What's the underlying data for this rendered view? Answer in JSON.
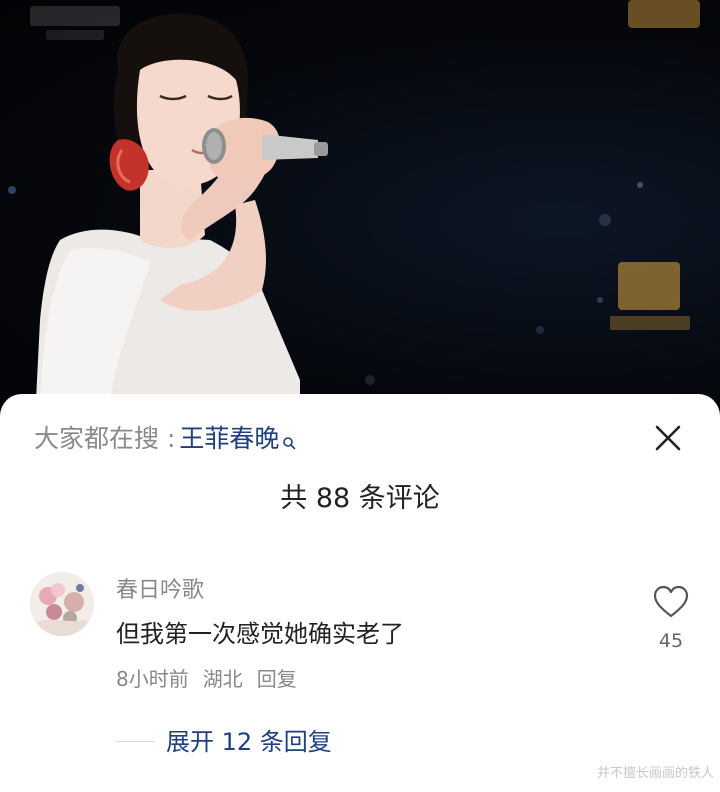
{
  "video": {
    "description_icon": "video-frame"
  },
  "sheet": {
    "search_prefix": "大家都在搜 : ",
    "search_term": "王菲春晚",
    "search_icon": "search-icon",
    "close_icon": "close-icon",
    "comment_count_title": "共 88 条评论"
  },
  "comment": {
    "username": "春日吟歌",
    "text": "但我第一次感觉她确实老了",
    "time": "8小时前",
    "location": "湖北",
    "reply_label": "回复",
    "like_icon": "heart-icon",
    "like_count": "45",
    "expand_replies_label": "展开 12 条回复"
  },
  "watermark": "并不擅长画画的铁人",
  "colors": {
    "link_blue": "#1f3f7f",
    "muted_gray": "#888888",
    "text_dark": "#222222"
  }
}
